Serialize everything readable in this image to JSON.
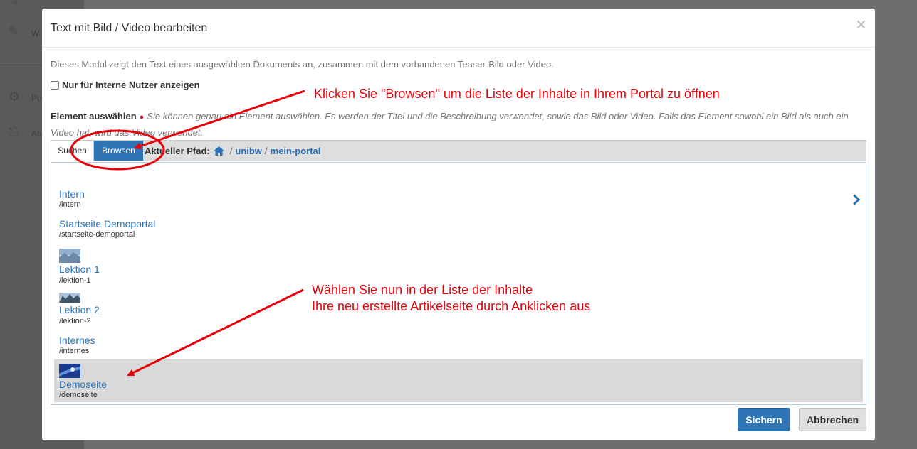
{
  "background": {
    "sidebar_items": [
      {
        "icon": "pencil-icon",
        "label": "W"
      },
      {
        "icon": "gears-icon",
        "label": "Po"
      },
      {
        "icon": "logout-icon",
        "label": "Ab"
      }
    ]
  },
  "modal": {
    "title": "Text mit Bild / Video bearbeiten",
    "close_label": "×",
    "description": "Dieses Modul zeigt den Text eines ausgewählten Dokuments an, zusammen mit dem vorhandenen Teaser-Bild oder Video.",
    "internal_only_label": "Nur für Interne Nutzer anzeigen",
    "internal_only_checked": false,
    "element_label": "Element auswählen",
    "required_marker": "●",
    "element_help": "Sie können genau ein Element auswählen. Es werden der Titel und die Beschreibung verwendet, sowie das Bild oder Video. Falls das Element sowohl ein Bild als auch ein Video hat, wird das Video verwendet.",
    "tabs": {
      "search": "Suchen",
      "browse": "Browsen"
    },
    "current_path_label": "Aktueller Pfad:",
    "path_separator": "/",
    "path_segments": [
      "unibw",
      "mein-portal"
    ],
    "items": [
      {
        "title": "Intern",
        "path": "/intern",
        "has_children": true
      },
      {
        "title": "Startseite Demoportal",
        "path": "/startseite-demoportal"
      },
      {
        "title": "Lektion 1",
        "path": "/lektion-1",
        "thumbnail": "image-thumbnail"
      },
      {
        "title": "Lektion 2",
        "path": "/lektion-2",
        "thumbnail": "image-thumbnail"
      },
      {
        "title": "Internes",
        "path": "/internes"
      },
      {
        "title": "Demoseite",
        "path": "/demoseite",
        "thumbnail": "image-thumbnail",
        "selected": true
      }
    ],
    "save_label": "Sichern",
    "cancel_label": "Abbrechen"
  },
  "annotations": {
    "browse_hint": "Klicken Sie \"Browsen\" um die Liste der Inhalte in Ihrem Portal zu öffnen",
    "select_hint_line1": "Wählen Sie nun in der Liste der Inhalte",
    "select_hint_line2": "Ihre neu erstellte Artikelseite durch Anklicken aus"
  },
  "colors": {
    "primary": "#2f75b5",
    "link": "#2a72b5",
    "annotation": "#e8000b",
    "required": "#c4183c",
    "selected_row": "#d9d9d9"
  }
}
